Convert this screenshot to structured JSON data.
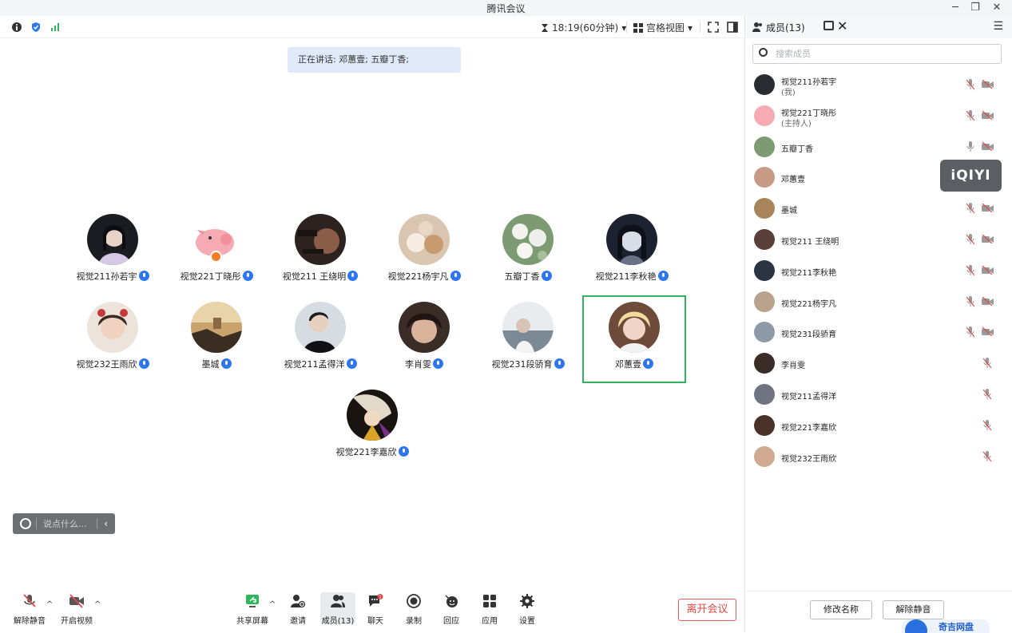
{
  "window": {
    "title": "腾讯会议",
    "controls": [
      "─",
      "❐",
      "✕"
    ]
  },
  "topbar": {
    "timer": "18:19(60分钟)",
    "view_label": "宫格视图"
  },
  "speaking": "正在讲话: 邓蕙壹; 五瓣丁香;",
  "participants": [
    {
      "name": "视觉211孙若宇"
    },
    {
      "name": "视觉221丁晓彤"
    },
    {
      "name": "视觉211 王绕明"
    },
    {
      "name": "视觉221杨宇凡"
    },
    {
      "name": "五瓣丁香"
    },
    {
      "name": "视觉211李秋艳"
    },
    {
      "name": "视觉232王雨欣"
    },
    {
      "name": "墨城"
    },
    {
      "name": "视觉211孟得洋"
    },
    {
      "name": "李肖雯"
    },
    {
      "name": "视觉231段骄育"
    },
    {
      "name": "邓蕙壹"
    },
    {
      "name": "视觉221李嘉欣"
    }
  ],
  "chat": {
    "placeholder": "说点什么..."
  },
  "toolbar": {
    "unmute": "解除静音",
    "start_video": "开启视频",
    "share": "共享屏幕",
    "invite": "邀请",
    "members": "成员(13)",
    "chat": "聊天",
    "chat_badge": "1",
    "record": "录制",
    "react": "回应",
    "apps": "应用",
    "settings": "设置",
    "leave": "离开会议"
  },
  "panel": {
    "title": "成员(13)",
    "search_placeholder": "搜索成员",
    "members": [
      {
        "name": "视觉211孙若宇",
        "sub": "(我)"
      },
      {
        "name": "视觉221丁晓彤",
        "sub": "(主持人)"
      },
      {
        "name": "五瓣丁香",
        "sub": ""
      },
      {
        "name": "邓蕙壹",
        "sub": ""
      },
      {
        "name": "墨城",
        "sub": ""
      },
      {
        "name": "视觉211 王绕明",
        "sub": ""
      },
      {
        "name": "视觉211李秋艳",
        "sub": ""
      },
      {
        "name": "视觉221杨宇凡",
        "sub": ""
      },
      {
        "name": "视觉231段骄育",
        "sub": ""
      },
      {
        "name": "李肖雯",
        "sub": ""
      },
      {
        "name": "视觉211孟得洋",
        "sub": ""
      },
      {
        "name": "视觉221李嘉欣",
        "sub": ""
      },
      {
        "name": "视觉232王雨欣",
        "sub": ""
      }
    ],
    "rename_button": "修改名称",
    "unmute_all_button": "解除静音",
    "watermark": "iQIYI",
    "netdisk": "奇吉网盘"
  },
  "colors": {
    "accent": "#2d76ee",
    "active_border": "#2fb55d",
    "leave": "#e24848"
  }
}
